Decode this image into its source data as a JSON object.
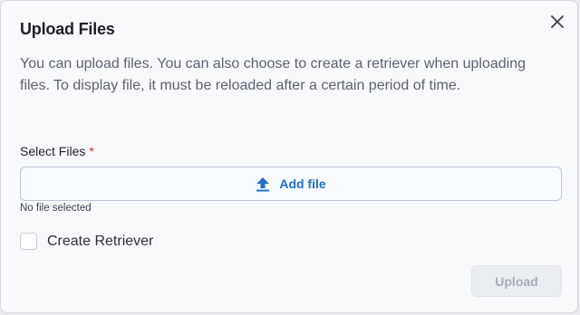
{
  "dialog": {
    "title": "Upload Files",
    "description": "You can upload files. You can also choose to create a retriever when uploading files. To display file, it must be reloaded after a certain period of time.",
    "select_label": "Select Files",
    "required_marker": "*",
    "add_file_label": "Add file",
    "file_status": "No file selected",
    "retriever_label": "Create Retriever",
    "retriever_checked": false,
    "upload_label": "Upload",
    "upload_disabled": true
  },
  "icons": {
    "close": "close-icon",
    "upload": "upload-arrow-icon"
  },
  "colors": {
    "accent": "#1f6fcf",
    "required": "#d92525",
    "disabled_text": "#a6adb8"
  }
}
